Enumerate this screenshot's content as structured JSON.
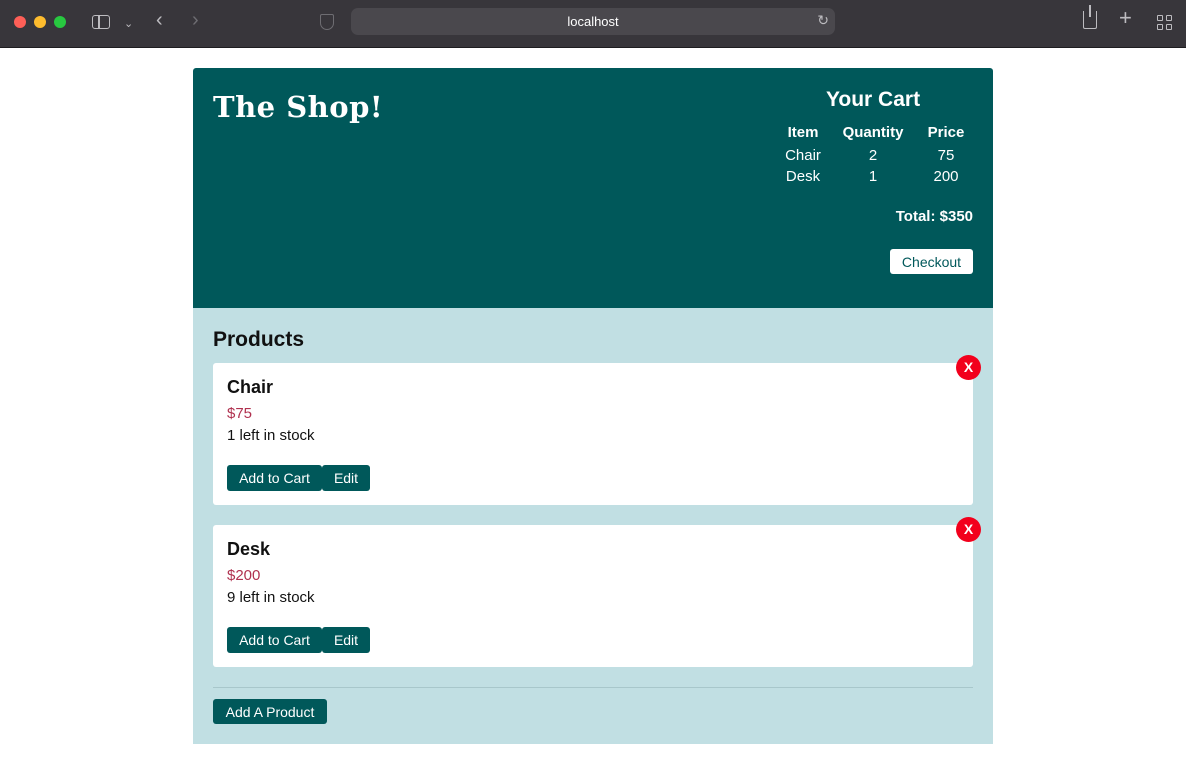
{
  "browser": {
    "address": "localhost"
  },
  "header": {
    "shop_title": "The Shop!"
  },
  "cart": {
    "title": "Your Cart",
    "columns": [
      "Item",
      "Quantity",
      "Price"
    ],
    "rows": [
      {
        "item": "Chair",
        "quantity": "2",
        "price": "75"
      },
      {
        "item": "Desk",
        "quantity": "1",
        "price": "200"
      }
    ],
    "total": "Total: $350",
    "checkout_label": "Checkout"
  },
  "products": {
    "title": "Products",
    "items": [
      {
        "name": "Chair",
        "price": "$75",
        "stock": "1 left in stock",
        "add_label": "Add to Cart",
        "edit_label": "Edit",
        "delete_label": "X"
      },
      {
        "name": "Desk",
        "price": "$200",
        "stock": "9 left in stock",
        "add_label": "Add to Cart",
        "edit_label": "Edit",
        "delete_label": "X"
      }
    ],
    "add_product_label": "Add A Product"
  },
  "colors": {
    "header_bg": "#00585a",
    "content_bg": "#c1dfe3",
    "price_text": "#b0314f",
    "delete_button": "#f2001c"
  }
}
